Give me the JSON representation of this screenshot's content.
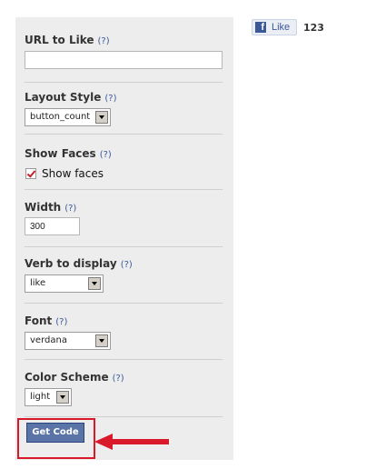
{
  "form": {
    "url": {
      "label": "URL to Like",
      "help": "(?)",
      "value": ""
    },
    "layout_style": {
      "label": "Layout Style",
      "help": "(?)",
      "selected": "button_count"
    },
    "show_faces": {
      "label": "Show Faces",
      "help": "(?)",
      "checkbox_label": "Show faces",
      "checked": true
    },
    "width": {
      "label": "Width",
      "help": "(?)",
      "value": "300"
    },
    "verb": {
      "label": "Verb to display",
      "help": "(?)",
      "selected": "like"
    },
    "font": {
      "label": "Font",
      "help": "(?)",
      "selected": "verdana"
    },
    "color_scheme": {
      "label": "Color Scheme",
      "help": "(?)",
      "selected": "light"
    },
    "get_code_label": "Get Code"
  },
  "preview": {
    "like_label": "Like",
    "count": "123"
  },
  "colors": {
    "panel_bg": "#ededed",
    "link": "#3b5998",
    "button_bg": "#5b74a8",
    "annotation": "#d9182a"
  }
}
